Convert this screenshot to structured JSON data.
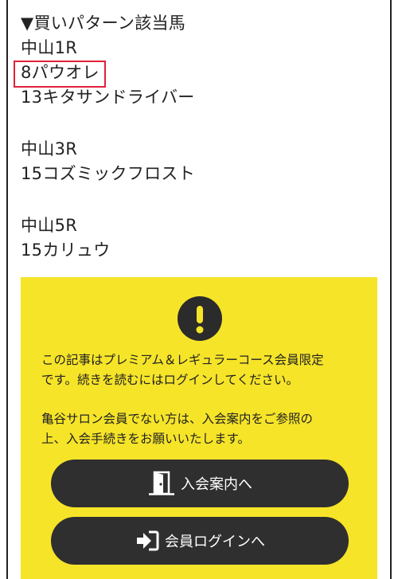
{
  "article": {
    "heading": "▼買いパターン該当馬",
    "race1": "中山1R",
    "race1_horse1": "8パウオレ",
    "race1_horse2": "13キタサンドライバー",
    "race3": "中山3R",
    "race3_horse1": "15コズミックフロスト",
    "race5": "中山5R",
    "race5_horse1": "15カリュウ"
  },
  "paywall": {
    "notice_line1": "この記事はプレミアム＆レギュラーコース会員限定",
    "notice_line2": "です。続きを読むにはログインしてください。",
    "notice_line3": "亀谷サロン会員でない方は、入会案内をご参照の",
    "notice_line4": "上、入会手続きをお願いいたします。",
    "join_button": "入会案内へ",
    "login_button": "会員ログインへ"
  },
  "colors": {
    "highlight_border": "#e0203a",
    "paywall_bg": "#f6e429",
    "button_bg": "#2f2f2f",
    "icon_bg": "#2b2b2b"
  },
  "icons": {
    "alert": "exclamation-circle-icon",
    "join": "door-open-icon",
    "login": "sign-in-icon"
  }
}
